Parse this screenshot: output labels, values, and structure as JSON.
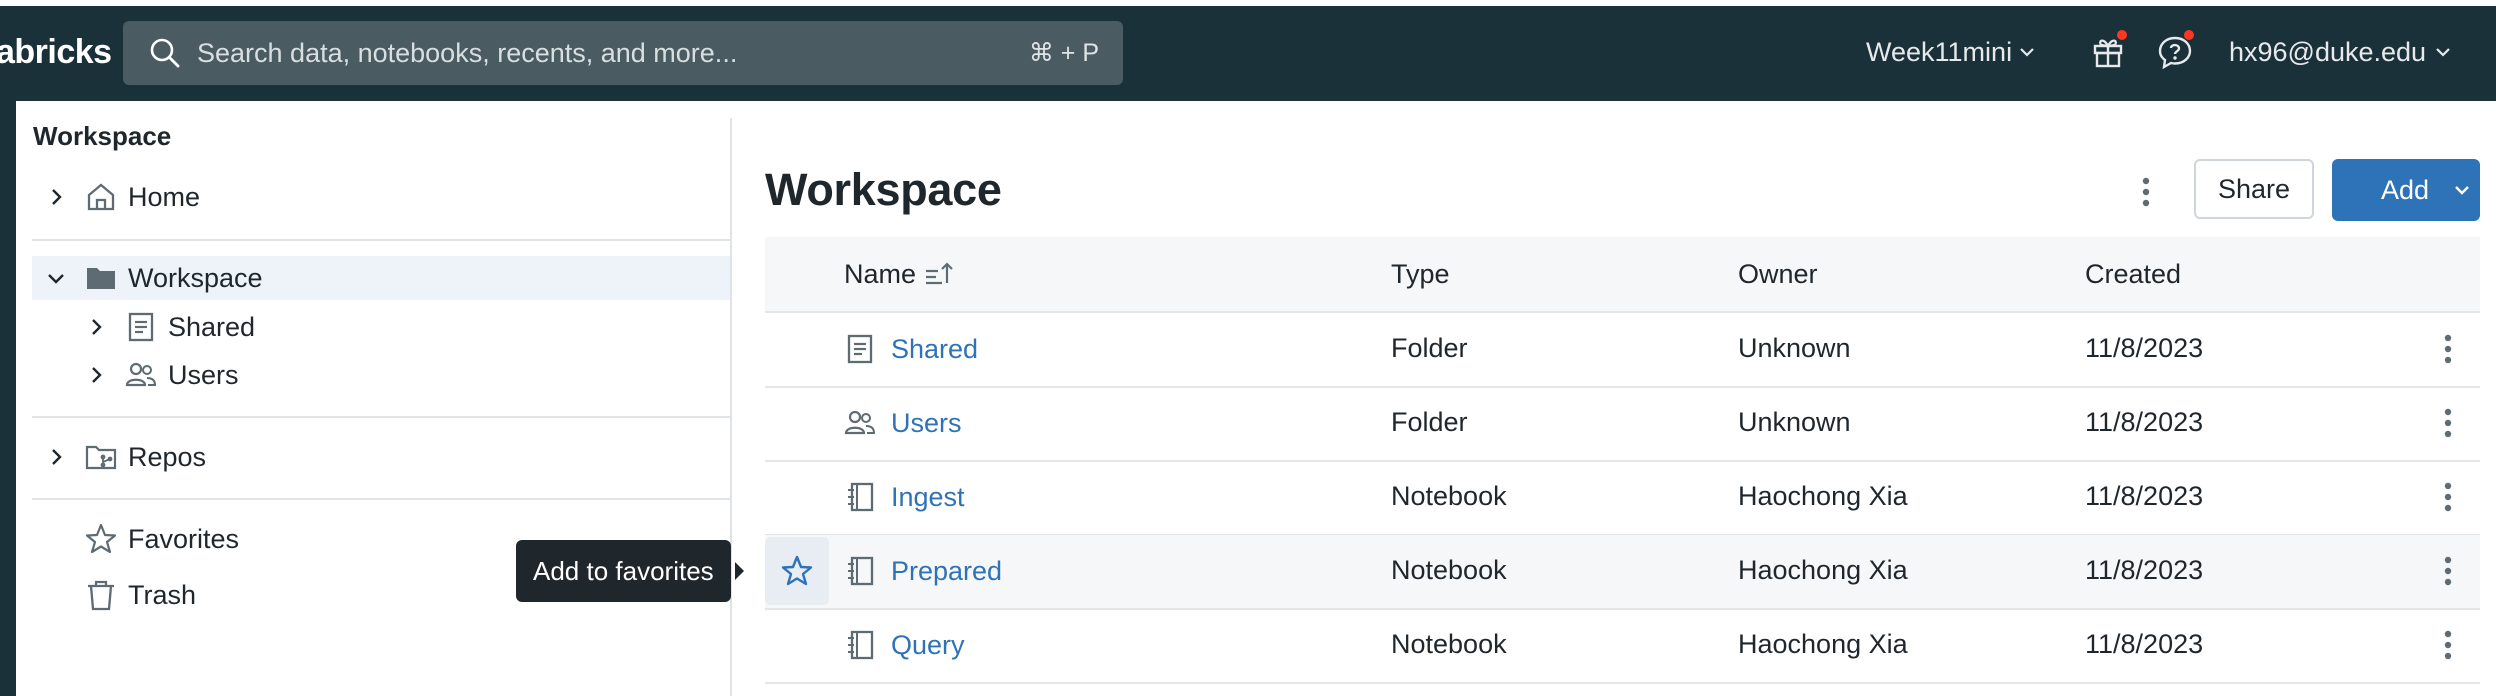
{
  "topbar": {
    "brand": "abricks",
    "search_placeholder": "Search data, notebooks, recents, and more...",
    "search_shortcut": "⌘ + P",
    "workspace_name": "Week11mini",
    "user_email": "hx96@duke.edu"
  },
  "sidebar": {
    "title": "Workspace",
    "items": [
      {
        "label": "Home"
      },
      {
        "label": "Workspace"
      },
      {
        "label": "Shared"
      },
      {
        "label": "Users"
      },
      {
        "label": "Repos"
      },
      {
        "label": "Favorites"
      },
      {
        "label": "Trash"
      }
    ]
  },
  "tooltip": {
    "text": "Add to favorites"
  },
  "main": {
    "title": "Workspace",
    "share_label": "Share",
    "add_label": "Add",
    "columns": {
      "name": "Name",
      "type": "Type",
      "owner": "Owner",
      "created": "Created"
    },
    "rows": [
      {
        "name": "Shared",
        "type": "Folder",
        "owner": "Unknown",
        "created": "11/8/2023",
        "icon": "shared-folder-icon"
      },
      {
        "name": "Users",
        "type": "Folder",
        "owner": "Unknown",
        "created": "11/8/2023",
        "icon": "users-folder-icon"
      },
      {
        "name": "Ingest",
        "type": "Notebook",
        "owner": "Haochong Xia",
        "created": "11/8/2023",
        "icon": "notebook-icon"
      },
      {
        "name": "Prepared",
        "type": "Notebook",
        "owner": "Haochong Xia",
        "created": "11/8/2023",
        "icon": "notebook-icon"
      },
      {
        "name": "Query",
        "type": "Notebook",
        "owner": "Haochong Xia",
        "created": "11/8/2023",
        "icon": "notebook-icon"
      }
    ]
  },
  "colors": {
    "topbar_bg": "#1b3139",
    "accent": "#2e72b8",
    "notification_badge": "#ff3621"
  }
}
